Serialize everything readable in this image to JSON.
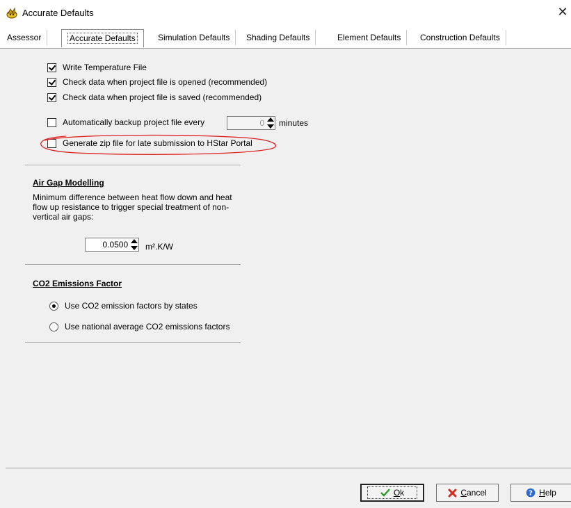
{
  "window": {
    "title": "Accurate Defaults",
    "close_symbol": "✕"
  },
  "tabs": [
    {
      "label": "Assessor",
      "active": false
    },
    {
      "label": "Accurate Defaults",
      "active": true
    },
    {
      "label": "Simulation Defaults",
      "active": false
    },
    {
      "label": "Shading Defaults",
      "active": false
    },
    {
      "label": "Element Defaults",
      "active": false
    },
    {
      "label": "Construction Defaults",
      "active": false
    }
  ],
  "options": {
    "write_temperature": {
      "label": "Write Temperature File",
      "checked": true
    },
    "check_on_open": {
      "label": "Check data when project file is opened (recommended)",
      "checked": true
    },
    "check_on_save": {
      "label": "Check data when project file is saved (recommended)",
      "checked": true
    },
    "auto_backup": {
      "label": "Automatically backup project file every",
      "checked": false,
      "value": "0",
      "unit": "minutes"
    },
    "generate_zip": {
      "label": "Generate zip file for late submission to HStar Portal",
      "checked": false
    }
  },
  "air_gap": {
    "title": "Air Gap Modelling",
    "description": "Minimum difference between heat flow down and heat flow up resistance to trigger special treatment of non-vertical air gaps:",
    "value": "0.0500",
    "unit": "m².K/W"
  },
  "co2": {
    "title": "CO2 Emissions Factor",
    "options": [
      {
        "label": "Use CO2 emission factors by states",
        "selected": true
      },
      {
        "label": "Use national average CO2 emissions factors",
        "selected": false
      }
    ]
  },
  "buttons": {
    "ok": "Ok",
    "cancel": "Cancel",
    "help": "Help"
  },
  "colors": {
    "annotation": "#e02020",
    "ok_check": "#2a9d2a",
    "cancel_x": "#d42a1a",
    "help_circle": "#2a6ad4"
  }
}
